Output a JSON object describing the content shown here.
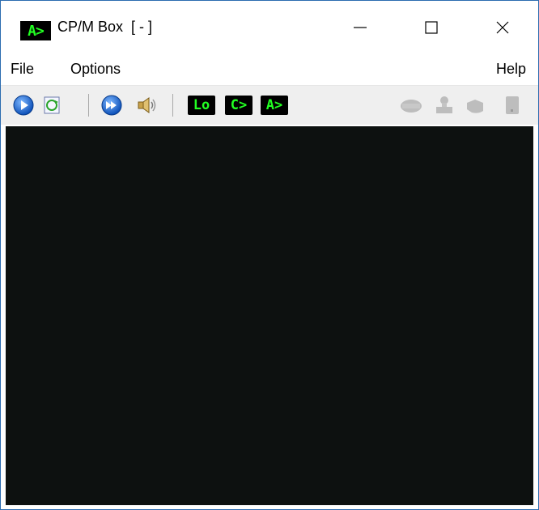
{
  "window": {
    "app_icon_text": "A>",
    "title": "CP/M Box  [ - ]",
    "controls": {
      "minimize": "—",
      "maximize": "☐",
      "close": "✕"
    }
  },
  "menu": {
    "file": "File",
    "options": "Options",
    "help": "Help"
  },
  "toolbar": {
    "lo_label": "Lo",
    "c_prompt": "C>",
    "a_prompt": "A>",
    "icons": [
      "play-icon",
      "refresh-icon",
      "fast-forward-icon",
      "speaker-icon",
      "lo-icon",
      "c-drive-icon",
      "a-drive-icon",
      "drive-icon",
      "stamp-icon",
      "hand-icon",
      "tape-icon"
    ]
  },
  "colors": {
    "terminal_bg": "#0d1110",
    "prompt_green": "#22ff22",
    "toolbar_bg": "#efefef",
    "accent_blue": "#1f6fd6"
  },
  "terminal": {
    "content": ""
  }
}
